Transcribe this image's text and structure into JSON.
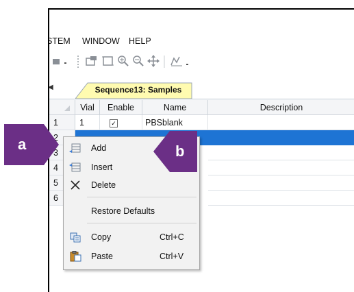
{
  "menu": {
    "system": "STEM",
    "window": "WINDOW",
    "help": "HELP"
  },
  "tab": {
    "label": "Sequence13: Samples"
  },
  "grid": {
    "headers": {
      "vial": "Vial",
      "enable": "Enable",
      "name": "Name",
      "description": "Description"
    },
    "rows": [
      {
        "num": "1",
        "vial": "1",
        "enabled": "✓",
        "name": "PBSblank"
      },
      {
        "num": "2"
      },
      {
        "num": "3"
      },
      {
        "num": "4"
      },
      {
        "num": "5"
      },
      {
        "num": "6"
      }
    ]
  },
  "context_menu": {
    "add": "Add",
    "insert": "Insert",
    "delete": "Delete",
    "restore_defaults": "Restore Defaults",
    "copy": "Copy",
    "copy_shortcut": "Ctrl+C",
    "paste": "Paste",
    "paste_shortcut": "Ctrl+V"
  },
  "callouts": {
    "a": "a",
    "b": "b"
  },
  "colors": {
    "selection": "#1e74d4",
    "callout": "#6b2f86",
    "tab": "#fffbb0"
  }
}
